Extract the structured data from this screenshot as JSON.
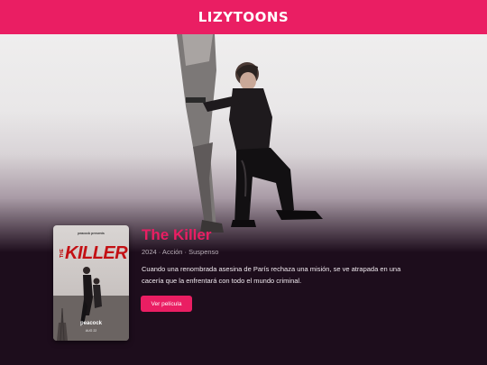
{
  "header": {
    "logo_text": "LIZYTOONS",
    "bg_color": "#ea1e63"
  },
  "hero": {
    "image_description_icon": "hero-backdrop-image"
  },
  "movie": {
    "title": "The Killer",
    "meta": "2024 · Acción · Suspenso",
    "description": "Cuando una renombrada asesina de París rechaza una misión, se ve atrapada en una cacería que la enfrentará con todo el mundo criminal.",
    "watch_label": "Ver película",
    "accent_color": "#ea1e63"
  },
  "poster": {
    "brand_top": "peacock presents",
    "title_small": "THE",
    "title_big": "KILLER",
    "network": "peacock",
    "release": "AUG 22"
  }
}
